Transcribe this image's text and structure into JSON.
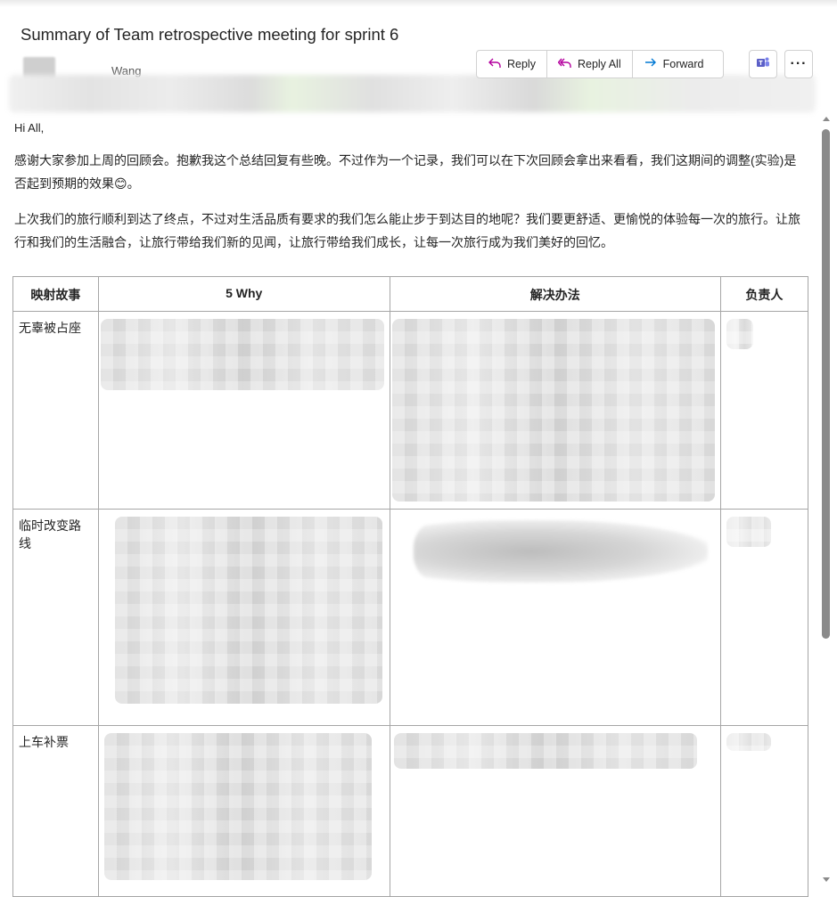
{
  "email": {
    "subject": "Summary of Team retrospective meeting for sprint 6",
    "sender_name_partial": "Wang"
  },
  "actions": {
    "reply_label": "Reply",
    "reply_all_label": "Reply All",
    "forward_label": "Forward",
    "more_label": "···"
  },
  "body": {
    "greeting": "Hi All,",
    "paragraph1": "感谢大家参加上周的回顾会。抱歉我这个总结回复有些晚。不过作为一个记录，我们可以在下次回顾会拿出来看看，我们这期间的调整(实验)是否起到预期的效果😊。",
    "paragraph2": "上次我们的旅行顺利到达了终点，不过对生活品质有要求的我们怎么能止步于到达目的地呢？我们要更舒适、更愉悦的体验每一次的旅行。让旅行和我们的生活融合，让旅行带给我们新的见闻，让旅行带给我们成长，让每一次旅行成为我们美好的回忆。"
  },
  "table": {
    "headers": [
      "映射故事",
      "5 Why",
      "解决办法",
      "负责人"
    ],
    "rows": [
      {
        "story": "无辜被占座"
      },
      {
        "story": "临时改变路线"
      },
      {
        "story": "上车补票"
      }
    ]
  },
  "colors": {
    "reply_icon": "#b4009e",
    "forward_icon": "#0078d4",
    "teams_icon": "#5b5fc7",
    "text": "#242424",
    "border": "#a6a6a6",
    "scrollbar": "#8a8a8a"
  }
}
